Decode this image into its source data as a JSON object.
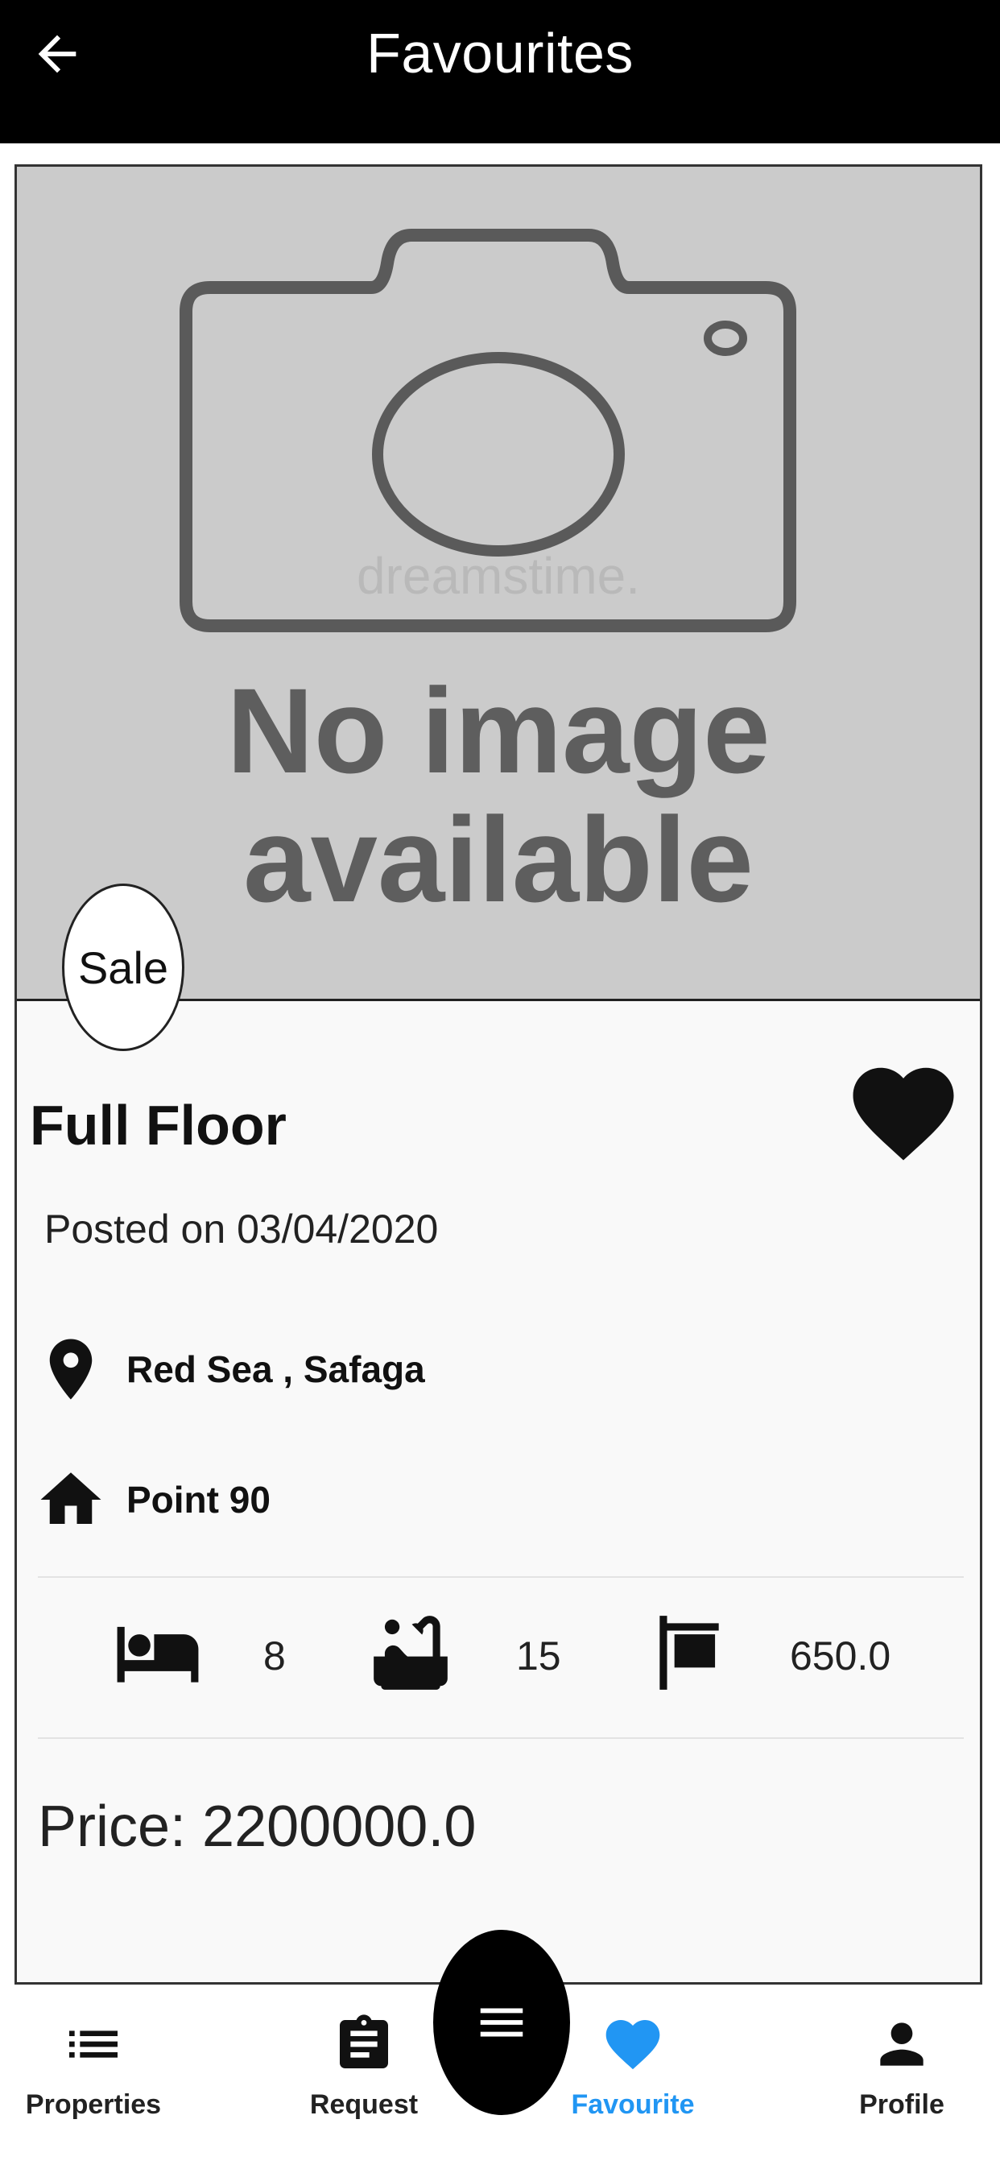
{
  "app_bar": {
    "title": "Favourites",
    "back_icon": "arrow-left-icon"
  },
  "listing": {
    "image_placeholder": {
      "line1": "No image",
      "line2": "available",
      "watermark": "dreamstime."
    },
    "badge": "Sale",
    "title": "Full Floor",
    "favourite_icon": "heart-icon",
    "posted": "Posted on 03/04/2020",
    "location": "Red Sea  ,  Safaga",
    "address": "Point 90",
    "bedrooms": "8",
    "bathrooms": "15",
    "area": "650.0",
    "price": "Price: 2200000.0"
  },
  "bottom_nav": {
    "items": [
      {
        "label": "Properties",
        "icon": "list-icon"
      },
      {
        "label": "Request",
        "icon": "clipboard-icon"
      },
      {
        "label": "Favourite",
        "icon": "heart-icon"
      },
      {
        "label": "Profile",
        "icon": "person-icon"
      }
    ],
    "active": "Favourite",
    "active_color": "#2196f3",
    "fab_icon": "menu-icon"
  }
}
